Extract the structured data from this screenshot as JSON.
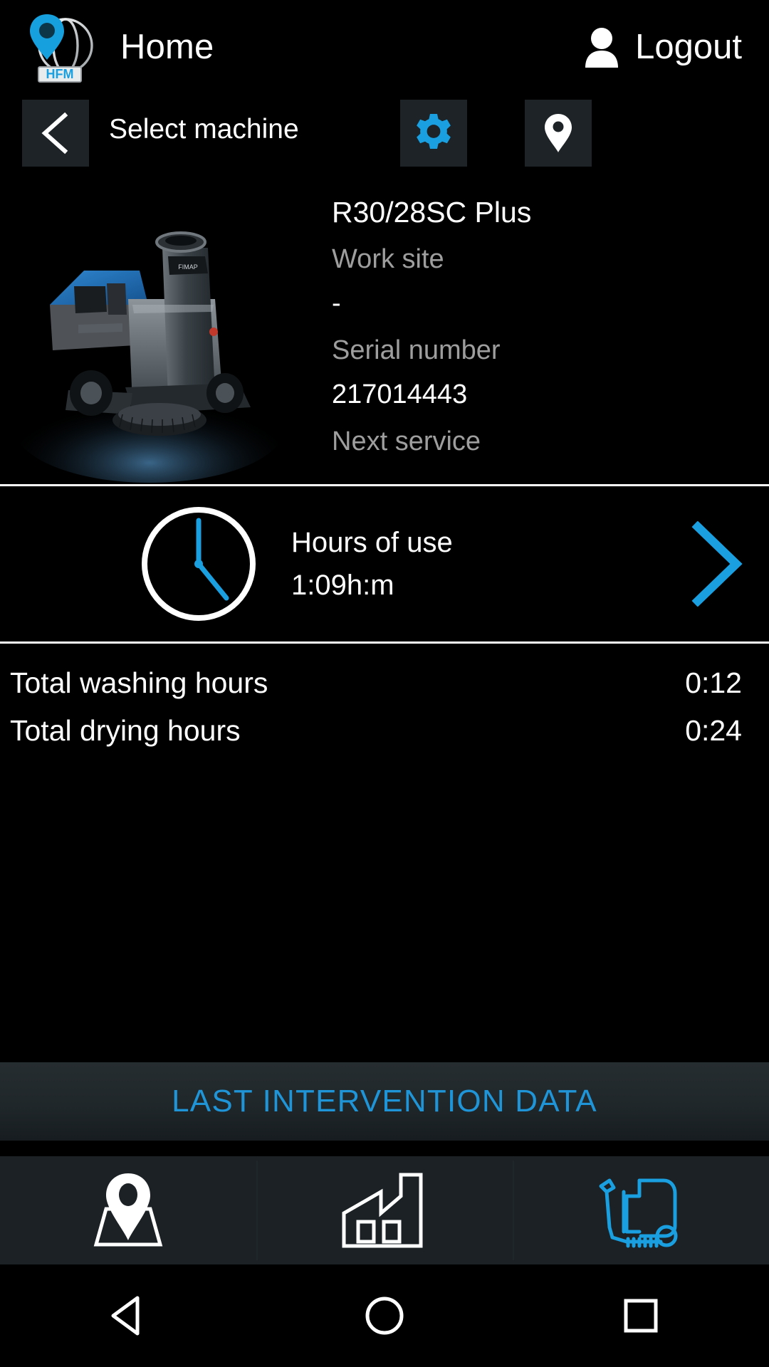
{
  "appbar": {
    "logo_text": "HFM",
    "logo_icon": "pin-globe-logo",
    "title": "Home",
    "logout_label": "Logout",
    "logout_icon": "person-icon"
  },
  "subbar": {
    "back_icon": "chevron-left-icon",
    "title": "Select machine",
    "settings_icon": "gear-icon",
    "location_icon": "map-pin-icon"
  },
  "machine": {
    "photo_alt": "ride-on-scrubber-photo",
    "model": "R30/28SC Plus",
    "fields": [
      {
        "label": "Work site",
        "value": "-"
      },
      {
        "label": "Serial number",
        "value": "217014443"
      },
      {
        "label": "Next service",
        "value": "-"
      }
    ]
  },
  "hours": {
    "clock_icon": "clock-icon",
    "title": "Hours of use",
    "value": "1:09h:m",
    "chevron_icon": "chevron-right-icon"
  },
  "totals": [
    {
      "label": "Total washing hours",
      "value": "0:12"
    },
    {
      "label": "Total drying hours",
      "value": "0:24"
    }
  ],
  "banner": {
    "label": "LAST INTERVENTION DATA"
  },
  "tabs": [
    {
      "name": "map",
      "icon": "map-pin-icon",
      "active": false
    },
    {
      "name": "plant",
      "icon": "factory-icon",
      "active": false
    },
    {
      "name": "machine",
      "icon": "scrubber-machine-icon",
      "active": true
    }
  ],
  "navbar": {
    "back_icon": "triangle-back-icon",
    "home_icon": "circle-home-icon",
    "recents_icon": "square-recents-icon"
  },
  "colors": {
    "accent_blue": "#1f95d8",
    "gear_blue": "#1a9fe0",
    "background": "#000000",
    "button_bg": "#1d2326",
    "banner_bg": "#222a2d",
    "tabbar_bg": "#1b2124",
    "label_gray": "#9e9e9e"
  }
}
